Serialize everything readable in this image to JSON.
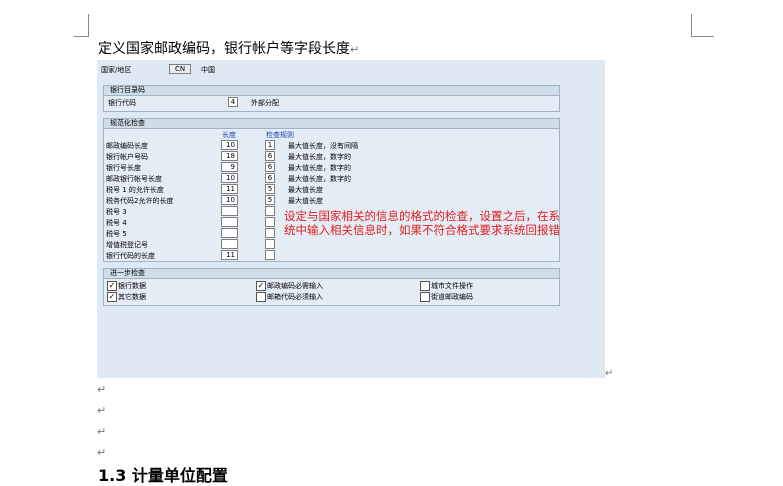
{
  "document": {
    "title": "定义国家邮政编码，银行帐户等字段长度",
    "paragraph_mark": "↵",
    "heading_next": "1.3 计量单位配置"
  },
  "sap": {
    "country_label": "国家/地区",
    "country_code": "CN",
    "country_name": "中国",
    "bank_directory": {
      "title": "银行目录码",
      "bank_code_label": "银行代码",
      "bank_code_value": "4",
      "bank_code_desc": "外部分配"
    },
    "format_check": {
      "title": "规范化检查",
      "col_length": "长度",
      "col_rule": "检查规则",
      "rows": [
        {
          "label": "邮政编码长度",
          "length": "10",
          "rule": "1",
          "desc": "最大值长度，没有间隔"
        },
        {
          "label": "银行帐户号码",
          "length": "18",
          "rule": "6",
          "desc": "最大值长度，数字的"
        },
        {
          "label": "银行号长度",
          "length": "9",
          "rule": "6",
          "desc": "最大值长度，数字的"
        },
        {
          "label": "邮政银行帐号长度",
          "length": "10",
          "rule": "6",
          "desc": "最大值长度，数字的"
        },
        {
          "label": "税号 1 的允许长度",
          "length": "11",
          "rule": "5",
          "desc": "最大值长度"
        },
        {
          "label": "税务代码2允许的长度",
          "length": "10",
          "rule": "5",
          "desc": "最大值长度"
        },
        {
          "label": "税号 3",
          "length": "",
          "rule": "",
          "desc": ""
        },
        {
          "label": "税号 4",
          "length": "",
          "rule": "",
          "desc": ""
        },
        {
          "label": "税号 5",
          "length": "",
          "rule": "",
          "desc": ""
        },
        {
          "label": "增值税登记号",
          "length": "",
          "rule": "",
          "desc": ""
        },
        {
          "label": "银行代码的长度",
          "length": "11",
          "rule": "",
          "desc": ""
        }
      ],
      "note": "设定与国家相关的信息的格式的检查，设置之后，在系统中输入相关信息时，如果不符合格式要求系统回报错"
    },
    "further_check": {
      "title": "进一步检查",
      "items": [
        {
          "label": "银行数据",
          "checked": true
        },
        {
          "label": "其它数据",
          "checked": true
        },
        {
          "label": "邮政编码必需输入",
          "checked": true
        },
        {
          "label": "邮箱代码必须输入",
          "checked": false
        },
        {
          "label": "城市文件操作",
          "checked": false
        },
        {
          "label": "街道邮政编码",
          "checked": false
        }
      ]
    }
  }
}
